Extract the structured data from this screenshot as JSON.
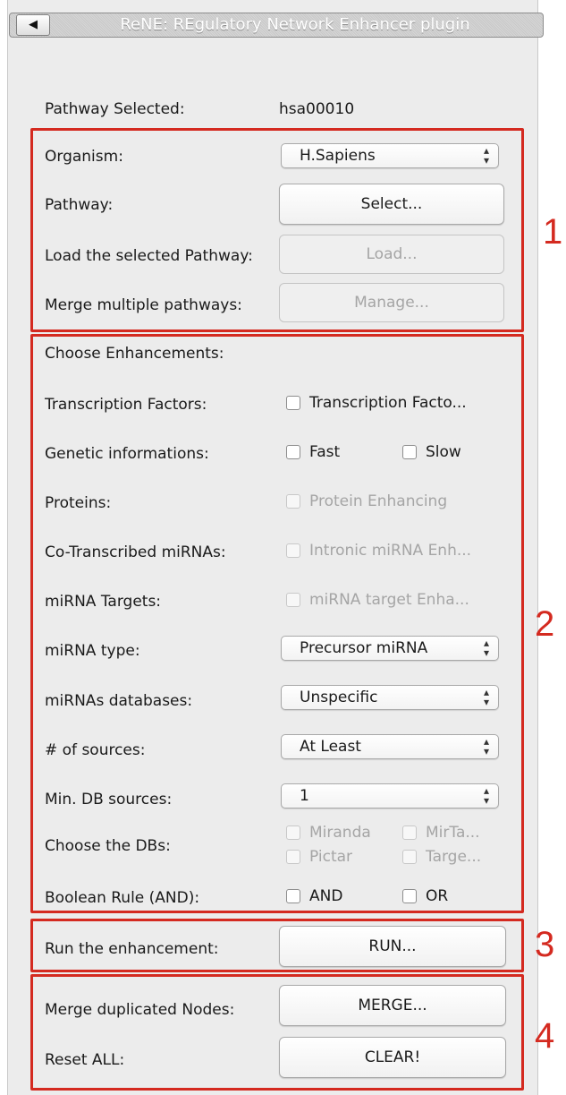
{
  "window": {
    "title": "ReNE: REgulatory Network Enhancer plugin",
    "collapse_glyph": "◀"
  },
  "pathway_selected": {
    "label": "Pathway Selected:",
    "value": "hsa00010"
  },
  "section1": {
    "number": "1",
    "organism": {
      "label": "Organism:",
      "value": "H.Sapiens"
    },
    "pathway": {
      "label": "Pathway:",
      "button": "Select..."
    },
    "load": {
      "label": "Load the selected Pathway:",
      "button": "Load..."
    },
    "merge": {
      "label": "Merge multiple pathways:",
      "button": "Manage..."
    }
  },
  "section2": {
    "number": "2",
    "header": "Choose Enhancements:",
    "tf": {
      "label": "Transcription Factors:",
      "checkbox": "Transcription Facto..."
    },
    "genetic": {
      "label": "Genetic informations:",
      "fast": "Fast",
      "slow": "Slow"
    },
    "proteins": {
      "label": "Proteins:",
      "checkbox": "Protein Enhancing"
    },
    "cotrans": {
      "label": "Co-Transcribed miRNAs:",
      "checkbox": "Intronic miRNA Enh..."
    },
    "mirna_targets": {
      "label": "miRNA Targets:",
      "checkbox": "miRNA target Enha..."
    },
    "mirna_type": {
      "label": "miRNA type:",
      "value": "Precursor miRNA"
    },
    "mirna_db": {
      "label": "miRNAs databases:",
      "value": "Unspecific"
    },
    "num_sources": {
      "label": "# of sources:",
      "value": "At Least"
    },
    "min_db": {
      "label": "Min. DB sources:",
      "value": "1"
    },
    "choose_dbs": {
      "label": "Choose the DBs:",
      "miranda": "Miranda",
      "mirta": "MirTa...",
      "pictar": "Pictar",
      "targe": "Targe..."
    },
    "boolean": {
      "label": "Boolean Rule (AND):",
      "and": "AND",
      "or": "OR"
    }
  },
  "section3": {
    "number": "3",
    "run": {
      "label": "Run the enhancement:",
      "button": "RUN..."
    }
  },
  "section4": {
    "number": "4",
    "merge_dup": {
      "label": "Merge duplicated Nodes:",
      "button": "MERGE..."
    },
    "reset": {
      "label": "Reset ALL:",
      "button": "CLEAR!"
    }
  },
  "icons": {
    "select_arrows": "up-down-arrows-icon",
    "collapse": "left-triangle-icon"
  },
  "colors": {
    "annotation_red": "#d42a20",
    "panel_bg": "#ececec",
    "disabled_text": "#a5a5a5"
  }
}
